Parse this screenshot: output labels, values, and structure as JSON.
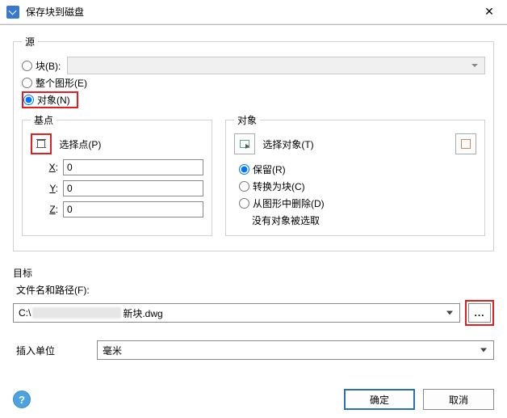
{
  "window": {
    "title": "保存块到磁盘",
    "close_glyph": "✕"
  },
  "source": {
    "legend": "源",
    "block_label": "块(B):",
    "drawing_label": "整个图形(E)",
    "objects_label": "对象(N)",
    "selected": "objects"
  },
  "basepoint": {
    "legend": "基点",
    "pick_label": "选择点(P)",
    "x_label": "X:",
    "y_label": "Y:",
    "z_label": "Z:",
    "x": "0",
    "y": "0",
    "z": "0"
  },
  "objects": {
    "legend": "对象",
    "select_label": "选择对象(T)",
    "retain_label": "保留(R)",
    "convert_label": "转换为块(C)",
    "delete_label": "从图形中删除(D)",
    "status": "没有对象被选取",
    "selected": "retain"
  },
  "destination": {
    "section": "目标",
    "path_label": "文件名和路径(F):",
    "path_prefix": "C:\\",
    "path_suffix": "新块.dwg",
    "browse": "...",
    "units_label": "插入单位",
    "units_value": "毫米"
  },
  "footer": {
    "help": "?",
    "ok": "确定",
    "cancel": "取消"
  }
}
